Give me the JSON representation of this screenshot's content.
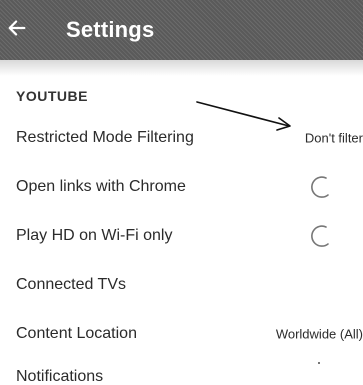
{
  "appbar": {
    "back_icon": "arrow-left-icon",
    "title": "Settings"
  },
  "section": {
    "header": "YOUTUBE"
  },
  "rows": [
    {
      "label": "Restricted Mode Filtering",
      "value": "Don't filter"
    },
    {
      "label": "Open links with Chrome",
      "toggle": "off"
    },
    {
      "label": "Play HD on Wi-Fi only",
      "toggle": "off"
    },
    {
      "label": "Connected TVs"
    },
    {
      "label": "Content Location",
      "value": "Worldwide (All)"
    },
    {
      "label": "Notifications"
    }
  ],
  "colors": {
    "appbar_bg": "#5a5a5a",
    "title_text": "#ffffff",
    "body_text": "#2b2b2b"
  }
}
